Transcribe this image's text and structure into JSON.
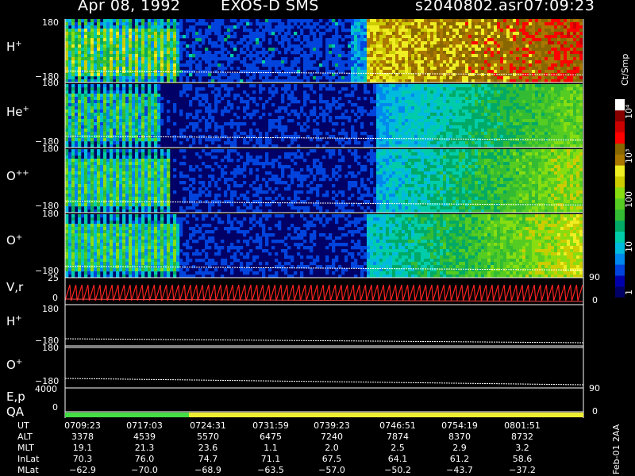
{
  "header": {
    "date": "Apr 08, 1992",
    "instrument": "EXOS-D SMS",
    "filename": "s2040802.asr",
    "time": "07:09:23"
  },
  "panels": [
    {
      "species_base": "H",
      "species_sup": "+",
      "ymax": "180",
      "ymin": "−180"
    },
    {
      "species_base": "He",
      "species_sup": "+",
      "ymax": "180",
      "ymin": "−180"
    },
    {
      "species_base": "O",
      "species_sup": "++",
      "ymax": "180",
      "ymin": "−180"
    },
    {
      "species_base": "O",
      "species_sup": "+",
      "ymax": "180",
      "ymin": "−180"
    }
  ],
  "vr_panel": {
    "label": "V,r",
    "ymax": "25",
    "ymin": "0",
    "right_top": "90",
    "right_bottom": "0"
  },
  "line_panels": [
    {
      "species_base": "H",
      "species_sup": "+",
      "ymax": "180",
      "ymin": "−180"
    },
    {
      "species_base": "O",
      "species_sup": "+",
      "ymax": "180",
      "ymin": "−180"
    }
  ],
  "ep_panel": {
    "label": "E,p",
    "ymax": "4000",
    "right_top": "90"
  },
  "qa_panel": {
    "label": "QA",
    "ymin": "0",
    "right_bottom": "0"
  },
  "colorbar": {
    "unit_label": "Ct/Smp",
    "tick_labels": [
      "1",
      "10",
      "100",
      "10³",
      "10⁴"
    ],
    "colors": [
      "#000066",
      "#0000aa",
      "#0044dd",
      "#0088ee",
      "#00bbdd",
      "#00ccaa",
      "#00aa66",
      "#33bb33",
      "#55cc22",
      "#88dd11",
      "#cccc00",
      "#eeee22",
      "#aa7700",
      "#886600",
      "#ff0000",
      "#cc0000",
      "#880000",
      "#ffffff"
    ]
  },
  "ephemeris": {
    "rows": [
      {
        "name": "UT",
        "values": [
          "0709:23",
          "0717:03",
          "0724:31",
          "0731:59",
          "0739:23",
          "0746:51",
          "0754:19",
          "0801:51"
        ]
      },
      {
        "name": "ALT",
        "values": [
          "3378",
          "4539",
          "5570",
          "6475",
          "7240",
          "7874",
          "8370",
          "8732"
        ]
      },
      {
        "name": "MLT",
        "values": [
          "19.1",
          "21.3",
          "23.6",
          "1.1",
          "2.0",
          "2.5",
          "2.9",
          "3.2"
        ]
      },
      {
        "name": "InLat",
        "values": [
          "70.3",
          "76.0",
          "74.7",
          "71.1",
          "67.5",
          "64.1",
          "61.2",
          "58.6"
        ]
      },
      {
        "name": "MLat",
        "values": [
          "−62.9",
          "−70.0",
          "−68.9",
          "−63.5",
          "−57.0",
          "−50.2",
          "−43.7",
          "−37.2"
        ]
      }
    ]
  },
  "side_stamp": "Feb-01 2AA",
  "chart_data": [
    {
      "type": "heatmap",
      "title": "H+",
      "y_range": [
        -180,
        180
      ],
      "x_range": [
        "07:09:23",
        "08:08:00"
      ]
    },
    {
      "type": "heatmap",
      "title": "He+",
      "y_range": [
        -180,
        180
      ],
      "x_range": [
        "07:09:23",
        "08:08:00"
      ]
    },
    {
      "type": "heatmap",
      "title": "O++",
      "y_range": [
        -180,
        180
      ],
      "x_range": [
        "07:09:23",
        "08:08:00"
      ]
    },
    {
      "type": "heatmap",
      "title": "O+",
      "y_range": [
        -180,
        180
      ],
      "x_range": [
        "07:09:23",
        "08:08:00"
      ]
    },
    {
      "type": "line",
      "title": "V,r",
      "y_range": [
        0,
        25
      ]
    },
    {
      "type": "line",
      "title": "H+",
      "y_range": [
        -180,
        180
      ]
    },
    {
      "type": "line",
      "title": "O+",
      "y_range": [
        -180,
        180
      ]
    },
    {
      "type": "line",
      "title": "E,p",
      "y_range": [
        0,
        4000
      ]
    },
    {
      "type": "bar",
      "title": "QA",
      "segments": [
        {
          "status": "good",
          "color": "#44dd44"
        },
        {
          "status": "fair",
          "color": "#eeee33"
        }
      ]
    }
  ]
}
